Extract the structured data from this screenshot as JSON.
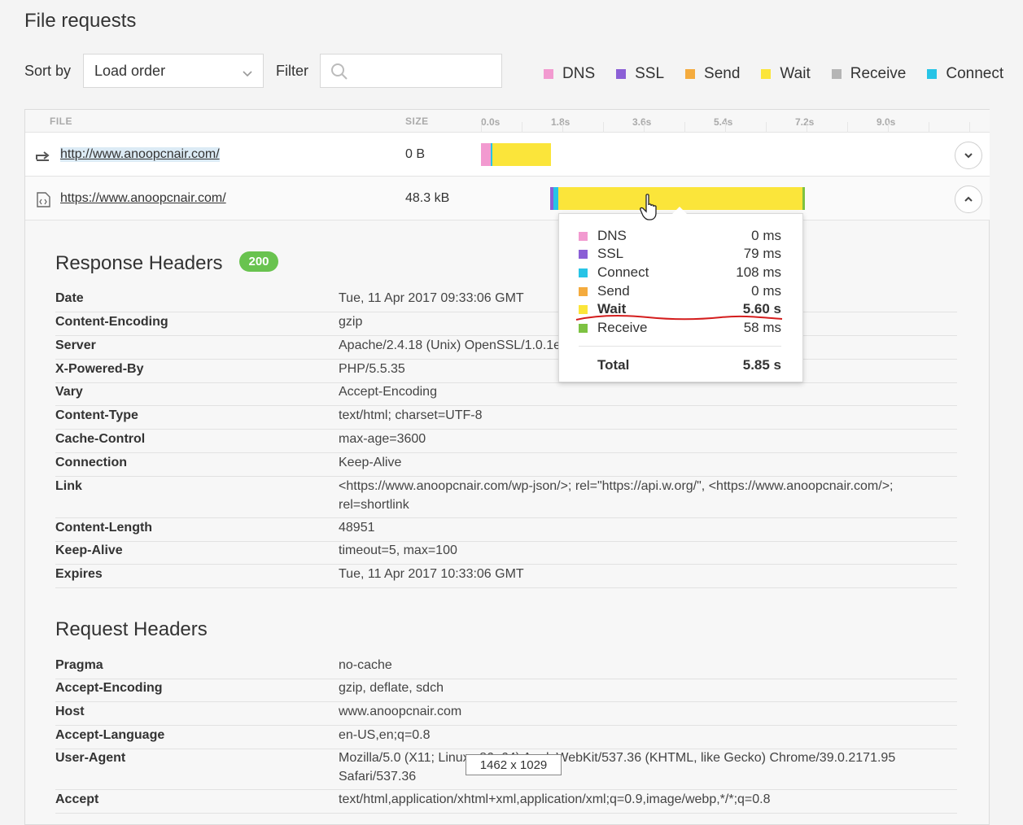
{
  "page": {
    "title": "File requests"
  },
  "controls": {
    "sort_label": "Sort by",
    "sort_value": "Load order",
    "filter_label": "Filter",
    "filter_value": ""
  },
  "legend": [
    {
      "label": "DNS",
      "color": "#f29ad0"
    },
    {
      "label": "SSL",
      "color": "#8b5fd6"
    },
    {
      "label": "Send",
      "color": "#f4ab3e"
    },
    {
      "label": "Wait",
      "color": "#fbe53a"
    },
    {
      "label": "Receive",
      "color": "#b5b5b5"
    },
    {
      "label": "Connect",
      "color": "#27c4e6"
    }
  ],
  "table": {
    "headers": {
      "file": "FILE",
      "size": "SIZE"
    },
    "ticks": [
      "0.0s",
      "1.8s",
      "3.6s",
      "5.4s",
      "7.2s",
      "9.0s"
    ],
    "rows": [
      {
        "url": "http://www.anoopcnair.com/",
        "size": "0 B",
        "icon": "redirect-icon",
        "expanded": false
      },
      {
        "url": "https://www.anoopcnair.com/",
        "size": "48.3 kB",
        "icon": "html-file-icon",
        "expanded": true
      }
    ]
  },
  "response_headers": {
    "title": "Response Headers",
    "status": "200",
    "items": [
      {
        "name": "Date",
        "value": "Tue, 11 Apr 2017 09:33:06 GMT"
      },
      {
        "name": "Content-Encoding",
        "value": "gzip"
      },
      {
        "name": "Server",
        "value": "Apache/2.4.18 (Unix) OpenSSL/1.0.1e"
      },
      {
        "name": "X-Powered-By",
        "value": "PHP/5.5.35"
      },
      {
        "name": "Vary",
        "value": "Accept-Encoding"
      },
      {
        "name": "Content-Type",
        "value": "text/html; charset=UTF-8"
      },
      {
        "name": "Cache-Control",
        "value": "max-age=3600"
      },
      {
        "name": "Connection",
        "value": "Keep-Alive"
      },
      {
        "name": "Link",
        "value": "<https://www.anoopcnair.com/wp-json/>; rel=\"https://api.w.org/\", <https://www.anoopcnair.com/>; rel=shortlink"
      },
      {
        "name": "Content-Length",
        "value": "48951"
      },
      {
        "name": "Keep-Alive",
        "value": "timeout=5, max=100"
      },
      {
        "name": "Expires",
        "value": "Tue, 11 Apr 2017 10:33:06 GMT"
      }
    ]
  },
  "request_headers": {
    "title": "Request Headers",
    "items": [
      {
        "name": "Pragma",
        "value": "no-cache"
      },
      {
        "name": "Accept-Encoding",
        "value": "gzip, deflate, sdch"
      },
      {
        "name": "Host",
        "value": "www.anoopcnair.com"
      },
      {
        "name": "Accept-Language",
        "value": "en-US,en;q=0.8"
      },
      {
        "name": "User-Agent",
        "value": "Mozilla/5.0 (X11; Linux x86_64) AppleWebKit/537.36 (KHTML, like Gecko) Chrome/39.0.2171.95 Safari/537.36"
      },
      {
        "name": "Accept",
        "value": "text/html,application/xhtml+xml,application/xml;q=0.9,image/webp,*/*;q=0.8"
      }
    ]
  },
  "tooltip": {
    "rows": [
      {
        "label": "DNS",
        "value": "0 ms",
        "color": "#f29ad0"
      },
      {
        "label": "SSL",
        "value": "79 ms",
        "color": "#8b5fd6"
      },
      {
        "label": "Connect",
        "value": "108 ms",
        "color": "#27c4e6"
      },
      {
        "label": "Send",
        "value": "0 ms",
        "color": "#f4ab3e"
      },
      {
        "label": "Wait",
        "value": "5.60 s",
        "color": "#fbe53a"
      },
      {
        "label": "Receive",
        "value": "58 ms",
        "color": "#7dc242"
      }
    ],
    "total_label": "Total",
    "total_value": "5.85 s"
  },
  "overlay": {
    "dimensions": "1462 x 1029"
  }
}
